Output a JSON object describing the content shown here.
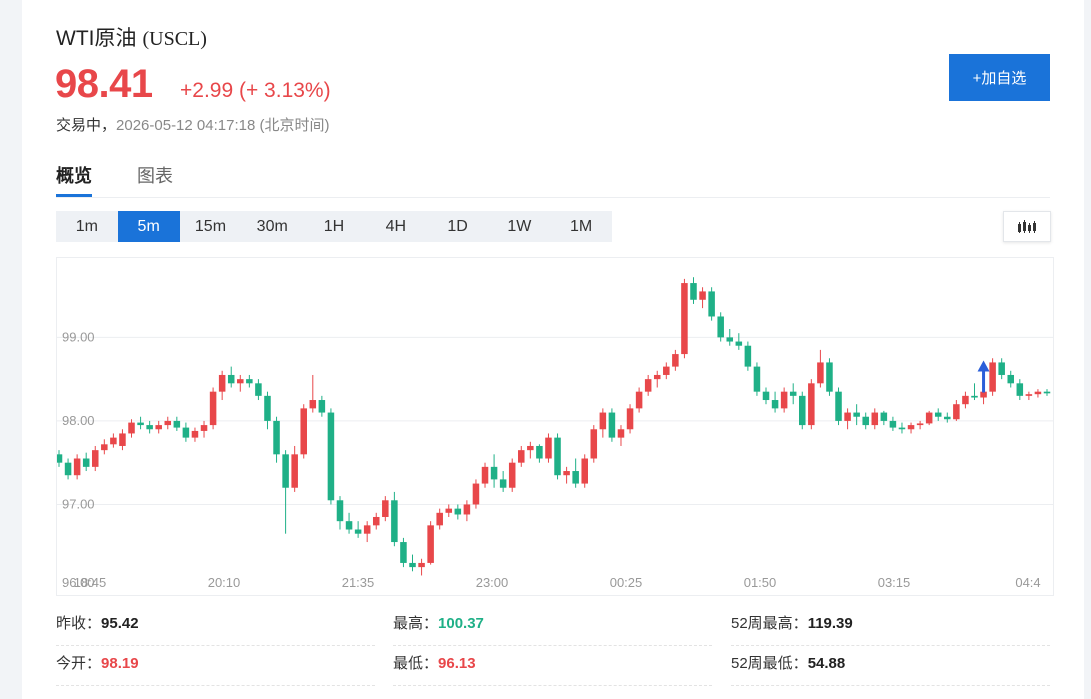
{
  "header": {
    "name": "WTI原油",
    "code": "(USCL)",
    "price": "98.41",
    "change": "+2.99 (+ 3.13%)",
    "status_label": "交易中，",
    "datetime": "2026-05-12 04:17:18",
    "timezone": "(北京时间)",
    "add_button": "+加自选"
  },
  "tabs": [
    {
      "label": "概览",
      "active": true
    },
    {
      "label": "图表",
      "active": false
    }
  ],
  "periods": [
    "1m",
    "5m",
    "15m",
    "30m",
    "1H",
    "4H",
    "1D",
    "1W",
    "1M"
  ],
  "active_period": "5m",
  "chart_type_icon": "candlestick-icon",
  "colors": {
    "up": "#e8474a",
    "down": "#1fb087",
    "accent": "#1a73d9",
    "marker": "#2b5fd9"
  },
  "chart_data": {
    "type": "candlestick",
    "y_ticks": [
      "99.00",
      "98.00",
      "97.00",
      "96.00"
    ],
    "x_ticks": [
      "18:45",
      "20:10",
      "21:35",
      "23:00",
      "00:25",
      "01:50",
      "03:15",
      "04:4"
    ],
    "ylim": [
      96.0,
      99.95
    ],
    "grid": true,
    "candles": [
      [
        97.6,
        97.65,
        97.45,
        97.5
      ],
      [
        97.5,
        97.55,
        97.3,
        97.35
      ],
      [
        97.35,
        97.6,
        97.3,
        97.55
      ],
      [
        97.55,
        97.62,
        97.4,
        97.45
      ],
      [
        97.45,
        97.7,
        97.4,
        97.65
      ],
      [
        97.65,
        97.78,
        97.6,
        97.72
      ],
      [
        97.72,
        97.85,
        97.68,
        97.8
      ],
      [
        97.7,
        97.9,
        97.65,
        97.85
      ],
      [
        97.85,
        98.02,
        97.8,
        97.98
      ],
      [
        97.98,
        98.05,
        97.9,
        97.95
      ],
      [
        97.95,
        98.0,
        97.85,
        97.9
      ],
      [
        97.9,
        98.0,
        97.85,
        97.95
      ],
      [
        97.95,
        98.05,
        97.9,
        98.0
      ],
      [
        98.0,
        98.05,
        97.88,
        97.92
      ],
      [
        97.92,
        97.98,
        97.75,
        97.8
      ],
      [
        97.8,
        97.92,
        97.75,
        97.88
      ],
      [
        97.88,
        98.0,
        97.8,
        97.95
      ],
      [
        97.95,
        98.4,
        97.9,
        98.35
      ],
      [
        98.35,
        98.6,
        98.25,
        98.55
      ],
      [
        98.55,
        98.65,
        98.4,
        98.45
      ],
      [
        98.45,
        98.55,
        98.35,
        98.5
      ],
      [
        98.5,
        98.55,
        98.4,
        98.45
      ],
      [
        98.45,
        98.5,
        98.25,
        98.3
      ],
      [
        98.3,
        98.35,
        97.9,
        98.0
      ],
      [
        98.0,
        98.05,
        97.5,
        97.6
      ],
      [
        97.6,
        97.65,
        96.65,
        97.2
      ],
      [
        97.2,
        97.7,
        97.15,
        97.6
      ],
      [
        97.6,
        98.2,
        97.55,
        98.15
      ],
      [
        98.15,
        98.55,
        98.1,
        98.25
      ],
      [
        98.25,
        98.3,
        98.05,
        98.1
      ],
      [
        98.1,
        98.15,
        97.0,
        97.05
      ],
      [
        97.05,
        97.1,
        96.7,
        96.8
      ],
      [
        96.8,
        96.9,
        96.65,
        96.7
      ],
      [
        96.7,
        96.8,
        96.6,
        96.65
      ],
      [
        96.65,
        96.8,
        96.55,
        96.75
      ],
      [
        96.75,
        96.9,
        96.7,
        96.85
      ],
      [
        96.85,
        97.1,
        96.8,
        97.05
      ],
      [
        97.05,
        97.15,
        96.5,
        96.55
      ],
      [
        96.55,
        96.6,
        96.25,
        96.3
      ],
      [
        96.3,
        96.4,
        96.2,
        96.25
      ],
      [
        96.25,
        96.35,
        96.15,
        96.3
      ],
      [
        96.3,
        96.8,
        96.28,
        96.75
      ],
      [
        96.75,
        96.95,
        96.7,
        96.9
      ],
      [
        96.9,
        97.0,
        96.85,
        96.95
      ],
      [
        96.95,
        97.0,
        96.82,
        96.88
      ],
      [
        96.88,
        97.05,
        96.8,
        97.0
      ],
      [
        97.0,
        97.3,
        96.95,
        97.25
      ],
      [
        97.25,
        97.5,
        97.2,
        97.45
      ],
      [
        97.45,
        97.6,
        97.2,
        97.3
      ],
      [
        97.3,
        97.4,
        97.15,
        97.2
      ],
      [
        97.2,
        97.55,
        97.15,
        97.5
      ],
      [
        97.5,
        97.7,
        97.45,
        97.65
      ],
      [
        97.65,
        97.75,
        97.55,
        97.7
      ],
      [
        97.7,
        97.72,
        97.5,
        97.55
      ],
      [
        97.55,
        97.85,
        97.5,
        97.8
      ],
      [
        97.8,
        97.85,
        97.3,
        97.35
      ],
      [
        97.35,
        97.45,
        97.25,
        97.4
      ],
      [
        97.4,
        97.55,
        97.2,
        97.25
      ],
      [
        97.25,
        97.6,
        97.2,
        97.55
      ],
      [
        97.55,
        97.95,
        97.5,
        97.9
      ],
      [
        97.9,
        98.15,
        97.8,
        98.1
      ],
      [
        98.1,
        98.15,
        97.75,
        97.8
      ],
      [
        97.8,
        97.95,
        97.7,
        97.9
      ],
      [
        97.9,
        98.2,
        97.85,
        98.15
      ],
      [
        98.15,
        98.4,
        98.1,
        98.35
      ],
      [
        98.35,
        98.55,
        98.3,
        98.5
      ],
      [
        98.5,
        98.6,
        98.4,
        98.55
      ],
      [
        98.55,
        98.7,
        98.5,
        98.65
      ],
      [
        98.65,
        98.85,
        98.6,
        98.8
      ],
      [
        98.8,
        99.7,
        98.75,
        99.65
      ],
      [
        99.65,
        99.72,
        99.4,
        99.45
      ],
      [
        99.45,
        99.6,
        99.35,
        99.55
      ],
      [
        99.55,
        99.6,
        99.2,
        99.25
      ],
      [
        99.25,
        99.3,
        98.95,
        99.0
      ],
      [
        99.0,
        99.1,
        98.9,
        98.95
      ],
      [
        98.95,
        99.05,
        98.85,
        98.9
      ],
      [
        98.9,
        98.95,
        98.6,
        98.65
      ],
      [
        98.65,
        98.7,
        98.3,
        98.35
      ],
      [
        98.35,
        98.4,
        98.2,
        98.25
      ],
      [
        98.25,
        98.35,
        98.1,
        98.15
      ],
      [
        98.15,
        98.4,
        98.1,
        98.35
      ],
      [
        98.35,
        98.45,
        98.2,
        98.3
      ],
      [
        98.3,
        98.35,
        97.9,
        97.95
      ],
      [
        97.95,
        98.5,
        97.9,
        98.45
      ],
      [
        98.45,
        98.85,
        98.4,
        98.7
      ],
      [
        98.7,
        98.75,
        98.3,
        98.35
      ],
      [
        98.35,
        98.4,
        97.95,
        98.0
      ],
      [
        98.0,
        98.15,
        97.9,
        98.1
      ],
      [
        98.1,
        98.2,
        97.95,
        98.05
      ],
      [
        98.05,
        98.1,
        97.9,
        97.95
      ],
      [
        97.95,
        98.15,
        97.9,
        98.1
      ],
      [
        98.1,
        98.12,
        97.95,
        98.0
      ],
      [
        98.0,
        98.05,
        97.88,
        97.92
      ],
      [
        97.92,
        97.98,
        97.85,
        97.9
      ],
      [
        97.9,
        97.98,
        97.85,
        97.95
      ],
      [
        97.95,
        98.0,
        97.9,
        97.97
      ],
      [
        97.97,
        98.12,
        97.95,
        98.1
      ],
      [
        98.1,
        98.15,
        98.0,
        98.05
      ],
      [
        98.05,
        98.1,
        97.98,
        98.02
      ],
      [
        98.02,
        98.25,
        98.0,
        98.2
      ],
      [
        98.2,
        98.35,
        98.15,
        98.3
      ],
      [
        98.3,
        98.45,
        98.25,
        98.28
      ],
      [
        98.28,
        98.4,
        98.2,
        98.35
      ],
      [
        98.35,
        98.75,
        98.3,
        98.7
      ],
      [
        98.7,
        98.75,
        98.5,
        98.55
      ],
      [
        98.55,
        98.6,
        98.4,
        98.45
      ],
      [
        98.45,
        98.5,
        98.25,
        98.3
      ],
      [
        98.3,
        98.35,
        98.25,
        98.32
      ],
      [
        98.32,
        98.38,
        98.28,
        98.35
      ],
      [
        98.35,
        98.38,
        98.3,
        98.33
      ]
    ],
    "marker": {
      "type": "arrow-up",
      "candle_index": 102
    }
  },
  "stats": [
    {
      "label": "昨收：",
      "value": "95.42",
      "color": "dark"
    },
    {
      "label": "最高：",
      "value": "100.37",
      "color": "green"
    },
    {
      "label": "52周最高：",
      "value": "119.39",
      "color": "dark"
    },
    {
      "label": "今开：",
      "value": "98.19",
      "color": "red"
    },
    {
      "label": "最低：",
      "value": "96.13",
      "color": "red"
    },
    {
      "label": "52周最低：",
      "value": "54.88",
      "color": "dark"
    }
  ]
}
